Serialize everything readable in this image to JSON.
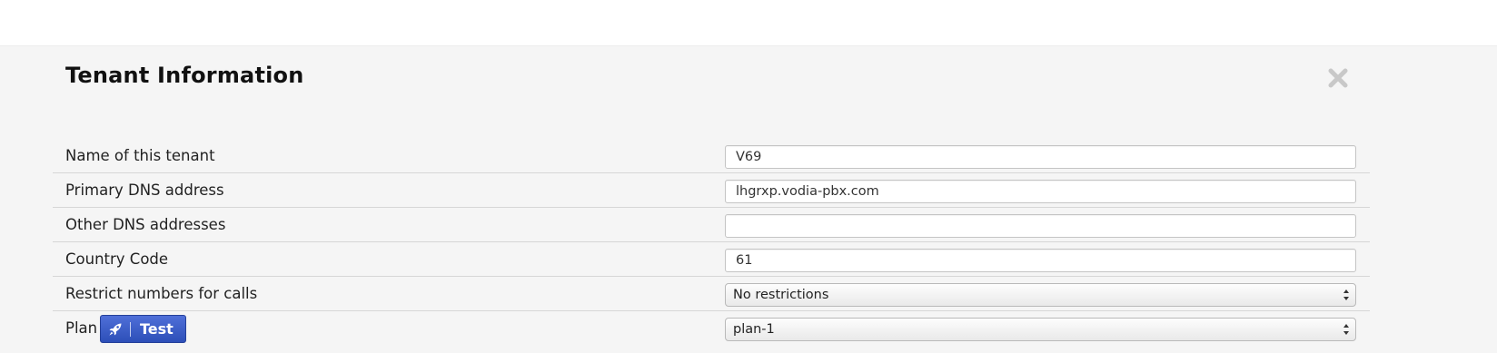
{
  "dialog": {
    "title": "Tenant Information",
    "close_icon": "close-icon"
  },
  "rows": [
    {
      "label": "Name of this tenant",
      "type": "text",
      "value": "V69"
    },
    {
      "label": "Primary DNS address",
      "type": "text",
      "value": "lhgrxp.vodia-pbx.com"
    },
    {
      "label": "Other DNS addresses",
      "type": "text",
      "value": ""
    },
    {
      "label": "Country Code",
      "type": "text",
      "value": "61"
    },
    {
      "label": "Restrict numbers for calls",
      "type": "select",
      "value": "No restrictions"
    },
    {
      "label": "Plan",
      "type": "select",
      "value": "plan-1"
    }
  ],
  "plan": {
    "test_button_label": "Test",
    "test_button_icon": "rocket-icon",
    "button_color": "#3a5bc7"
  },
  "colors": {
    "panel_bg": "#f5f5f5",
    "close_icon": "#c8c8c8",
    "divider": "#d6d6d6"
  }
}
